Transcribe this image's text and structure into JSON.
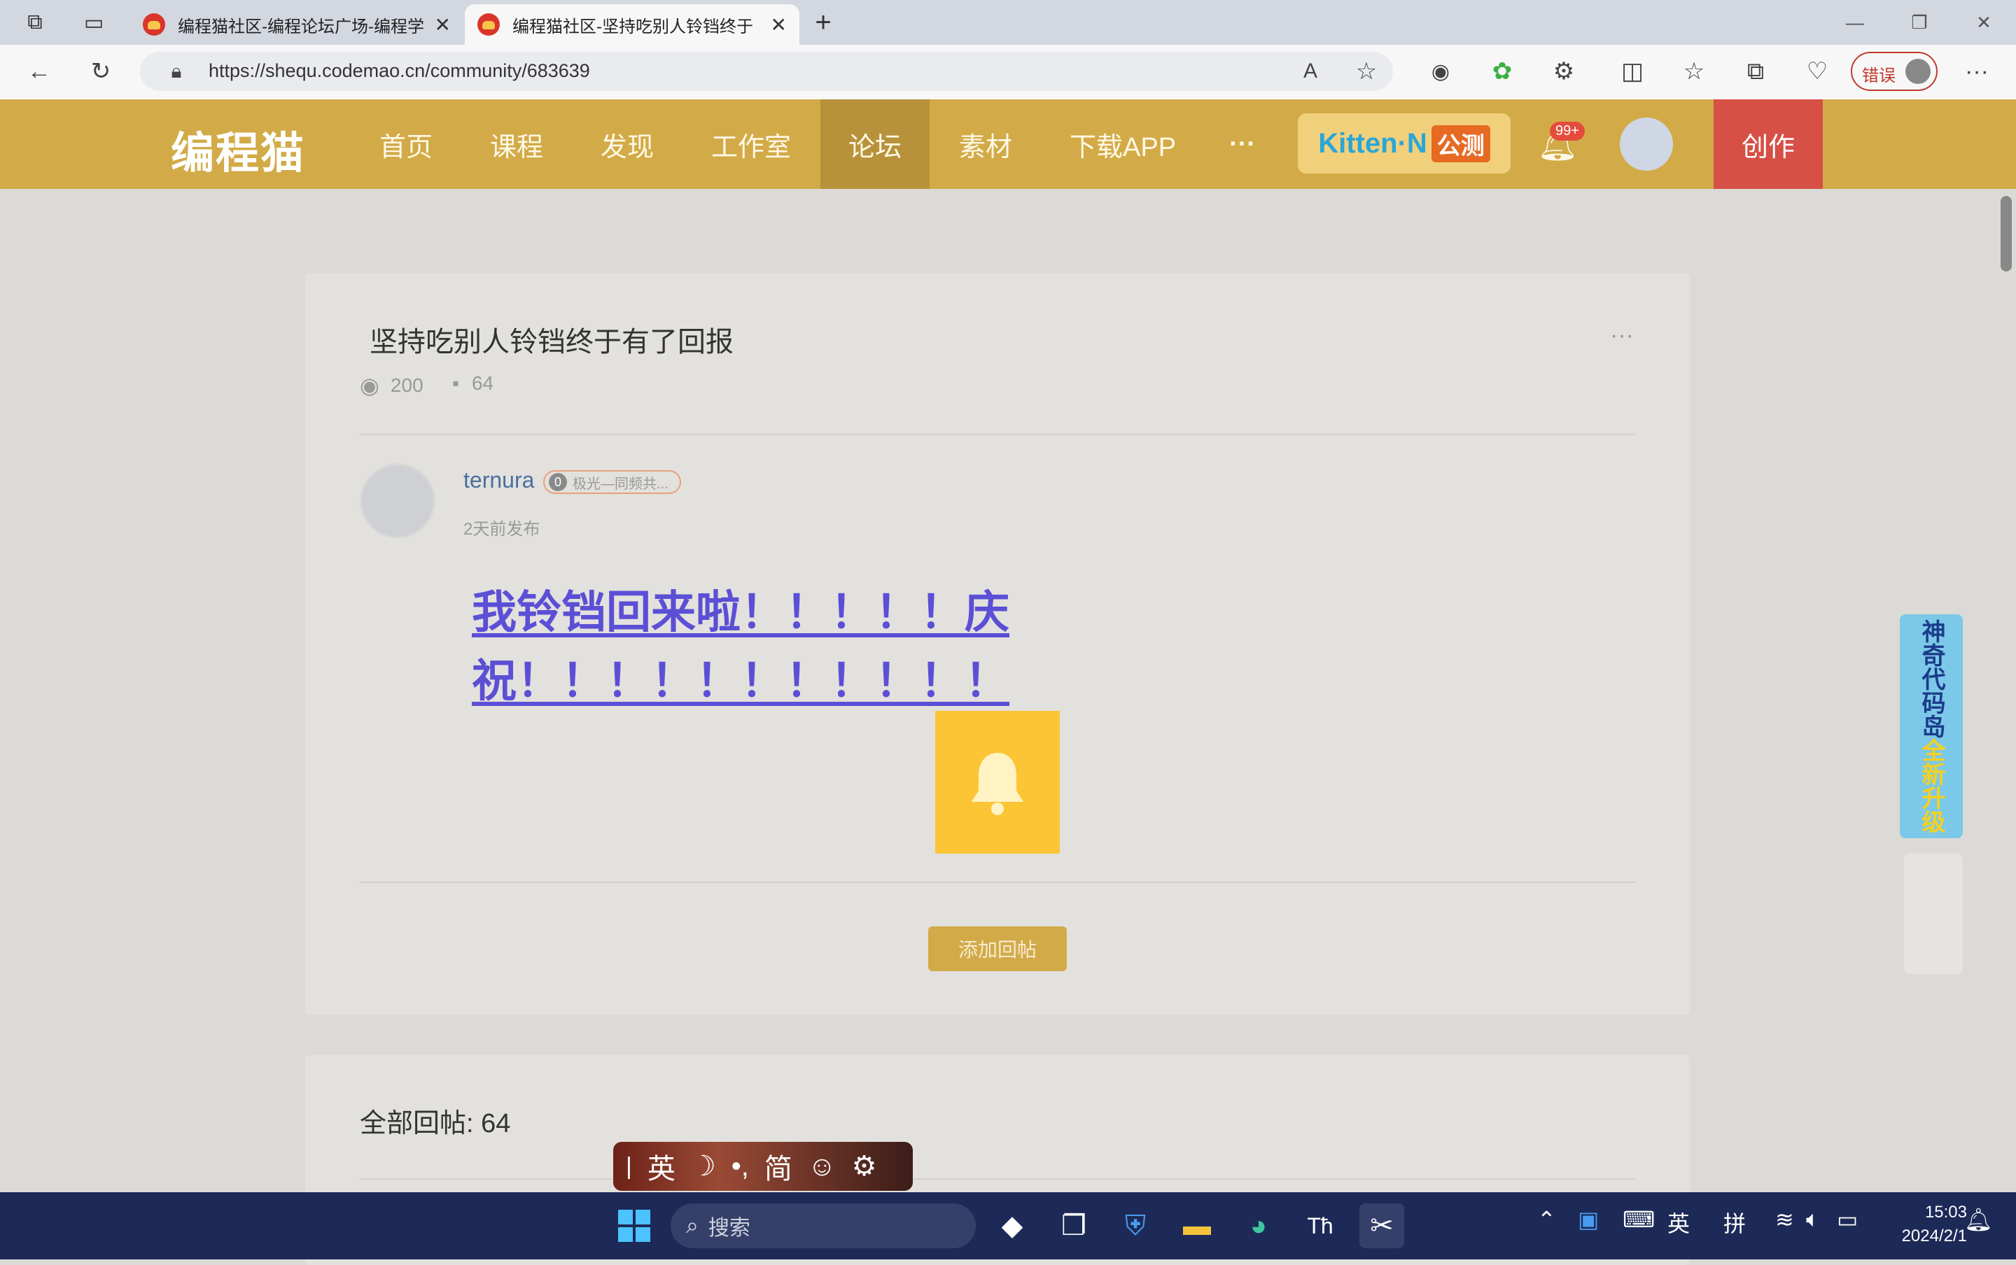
{
  "browser": {
    "tabs": [
      {
        "title": "编程猫社区-编程论坛广场-编程学"
      },
      {
        "title": "编程猫社区-坚持吃别人铃铛终于"
      }
    ],
    "url": "https://shequ.codemao.cn/community/683639",
    "error_label": "错误"
  },
  "site": {
    "logo": "编程猫",
    "nav": [
      "首页",
      "课程",
      "发现",
      "工作室",
      "论坛",
      "素材",
      "下载APP"
    ],
    "more": "···",
    "kitten": "Kitten·N",
    "kitten_tag": "公测",
    "notif_badge": "99+",
    "create_label": "创作"
  },
  "post": {
    "title": "坚持吃别人铃铛终于有了回报",
    "views": "200",
    "comments": "64",
    "author": "ternura",
    "badge_level": "0",
    "badge_text": "极光—同频共...",
    "time_ago": "2天前发布",
    "content_line1": "我铃铛回来啦！！！！！庆",
    "content_line2": "祝！！！！！！！！！！！",
    "reply_button": "添加回帖",
    "total_replies": "全部回帖: 64",
    "more_icon": "···"
  },
  "side_ad": {
    "text1": "神奇代码岛",
    "text2": "全新升级"
  },
  "ime": {
    "lang": "英",
    "moon": "☽",
    "punct": "•,",
    "mode": "简",
    "emoji": "☺",
    "gear": "⚙"
  },
  "taskbar": {
    "search_placeholder": "搜索",
    "tray_lang": "英",
    "tray_ime": "拼",
    "time": "15:03",
    "date": "2024/2/1"
  },
  "colors": {
    "header": "#d2ab48",
    "nav_active": "#b8923b",
    "create": "#d65046",
    "link": "#5b4fd6"
  }
}
